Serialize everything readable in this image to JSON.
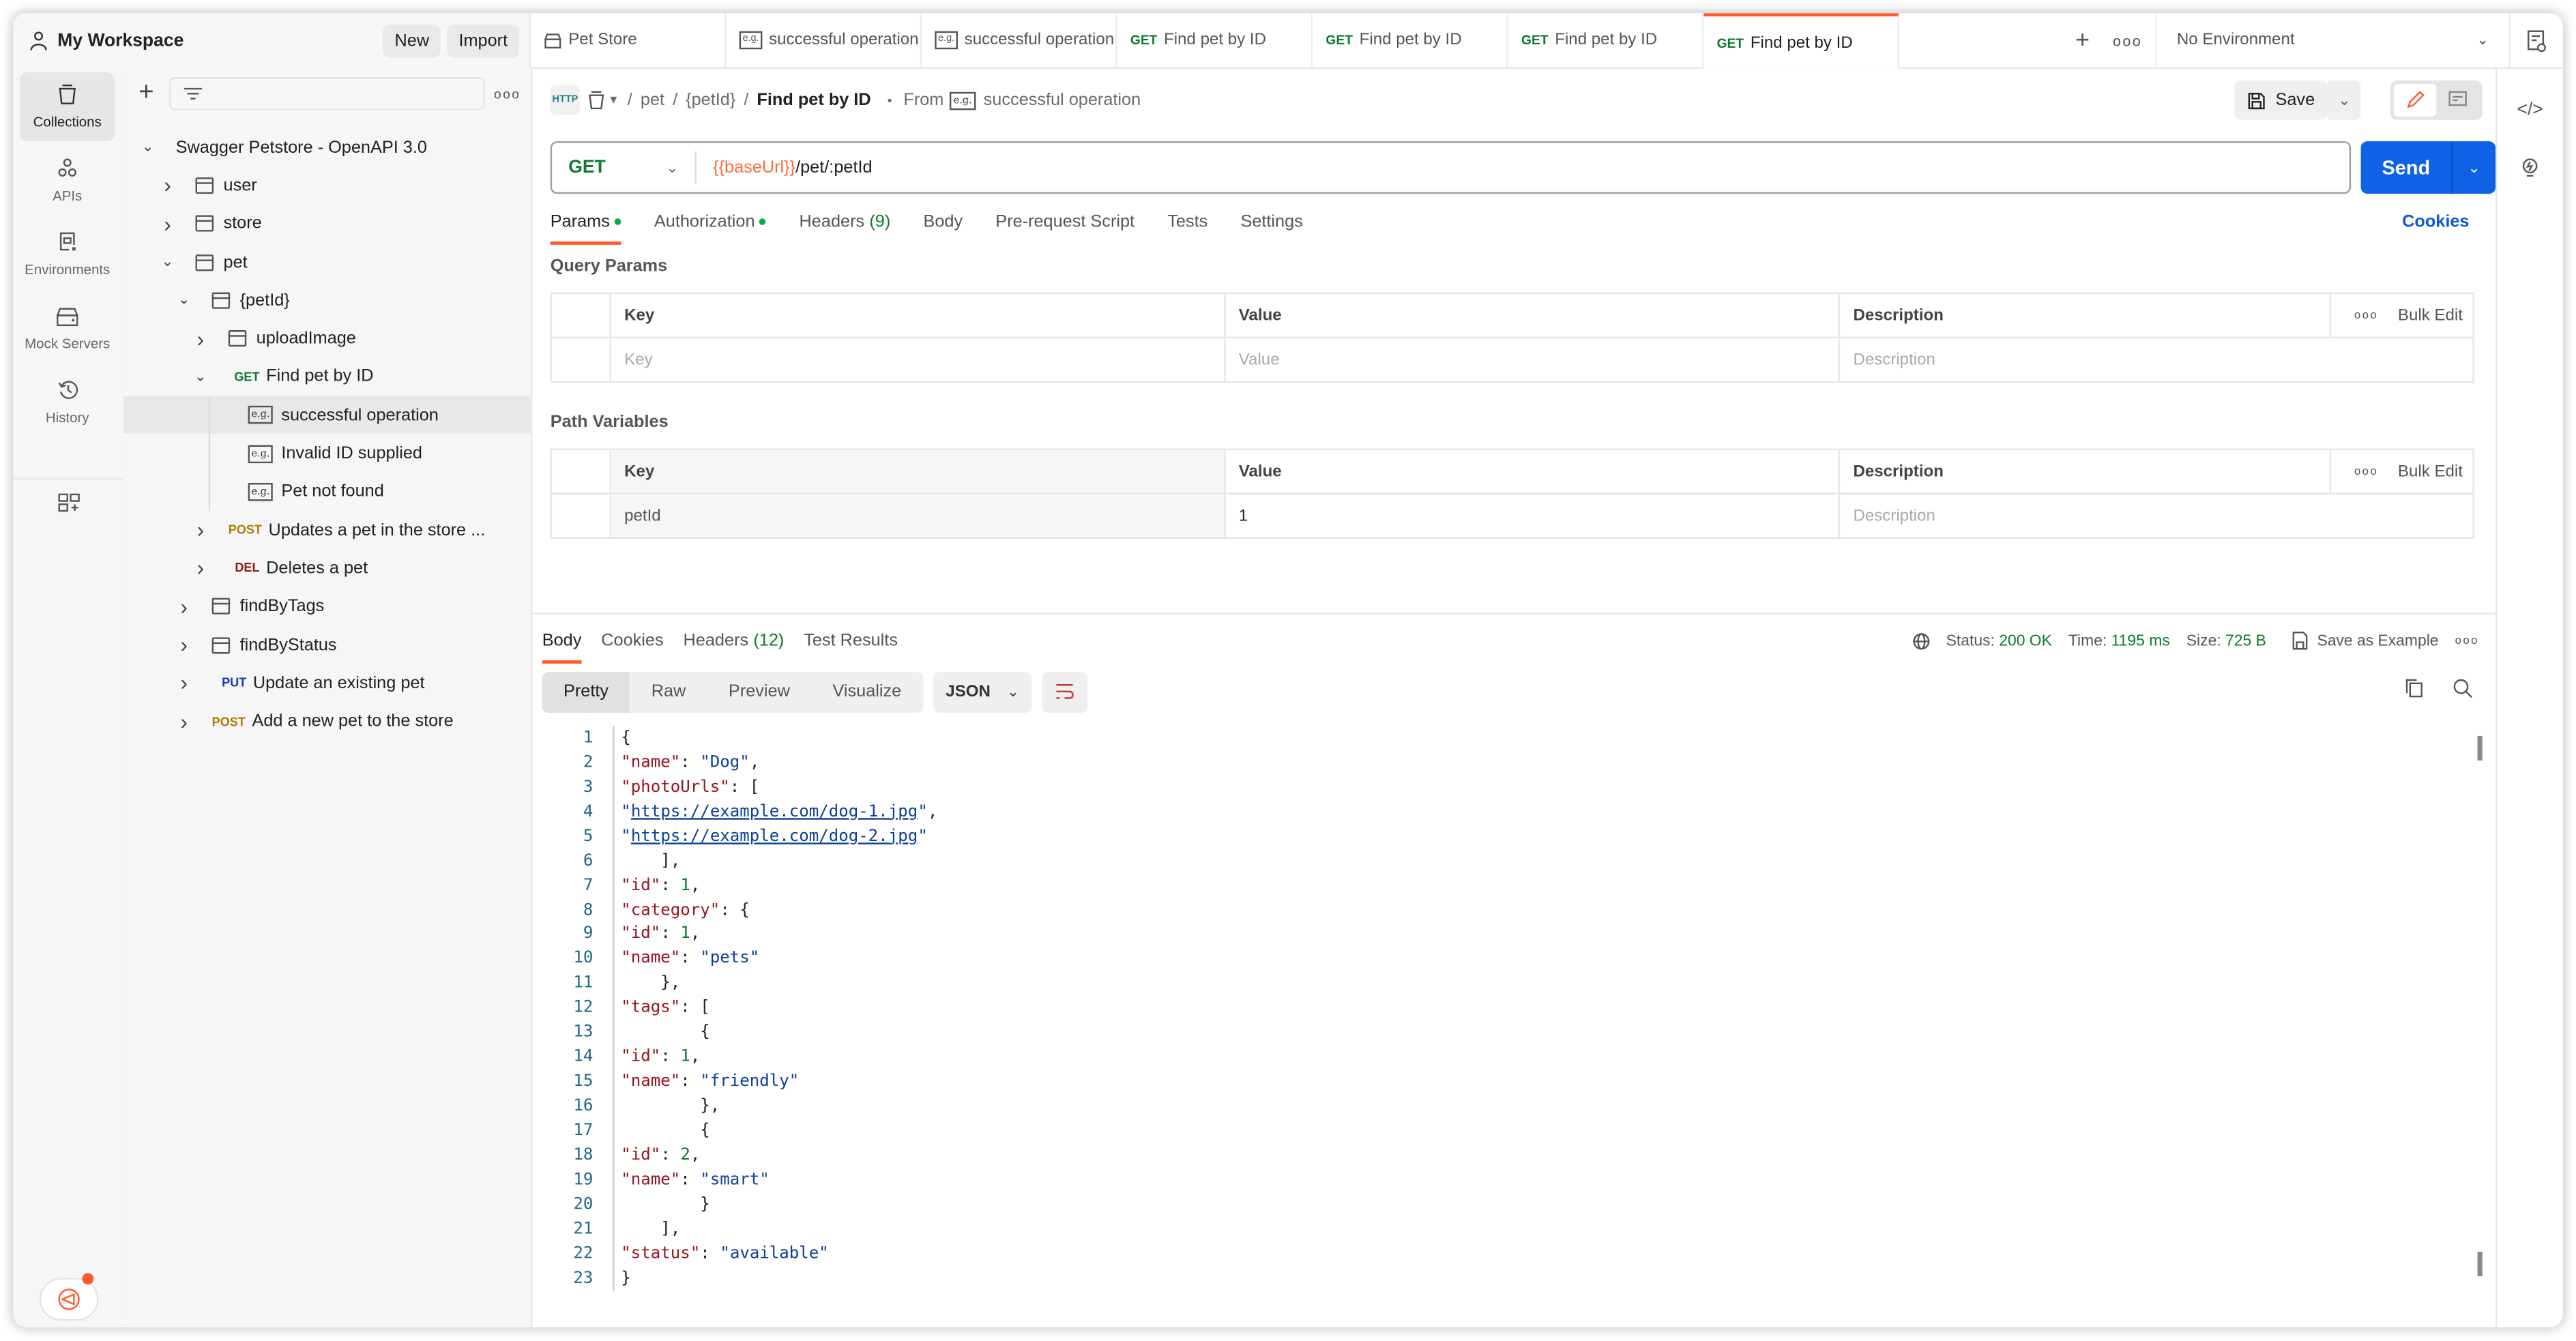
{
  "workspace": {
    "title": "My Workspace",
    "new_label": "New",
    "import_label": "Import"
  },
  "tabs": [
    {
      "icon": "mock-server-icon",
      "method": "",
      "label": "Pet Store",
      "active": false
    },
    {
      "icon": "example-icon",
      "method": "",
      "label": "successful operation",
      "active": false
    },
    {
      "icon": "example-icon",
      "method": "",
      "label": "successful operation",
      "active": false
    },
    {
      "icon": "",
      "method": "GET",
      "label": "Find pet by ID",
      "active": false
    },
    {
      "icon": "",
      "method": "GET",
      "label": "Find pet by ID",
      "active": false
    },
    {
      "icon": "",
      "method": "GET",
      "label": "Find pet by ID",
      "active": false
    },
    {
      "icon": "",
      "method": "GET",
      "label": "Find pet by ID",
      "active": true
    }
  ],
  "environment": {
    "selected": "No Environment"
  },
  "leftnav": [
    {
      "label": "Collections",
      "icon": "collections-icon",
      "active": true
    },
    {
      "label": "APIs",
      "icon": "apis-icon",
      "active": false
    },
    {
      "label": "Environments",
      "icon": "environments-icon",
      "active": false
    },
    {
      "label": "Mock Servers",
      "icon": "mock-servers-icon",
      "active": false
    },
    {
      "label": "History",
      "icon": "history-icon",
      "active": false
    }
  ],
  "tree": {
    "collection": "Swagger Petstore - OpenAPI 3.0",
    "items": [
      {
        "depth": 1,
        "chev": "right",
        "type": "folder",
        "label": "user"
      },
      {
        "depth": 1,
        "chev": "right",
        "type": "folder",
        "label": "store"
      },
      {
        "depth": 1,
        "chev": "down",
        "type": "folder",
        "label": "pet"
      },
      {
        "depth": 2,
        "chev": "down",
        "type": "folder",
        "label": "{petId}"
      },
      {
        "depth": 3,
        "chev": "right",
        "type": "folder",
        "label": "uploadImage"
      },
      {
        "depth": 3,
        "chev": "down",
        "type": "request",
        "method": "GET",
        "label": "Find pet by ID"
      },
      {
        "depth": 4,
        "chev": "",
        "type": "example",
        "label": "successful operation",
        "selected": true
      },
      {
        "depth": 4,
        "chev": "",
        "type": "example",
        "label": "Invalid ID supplied"
      },
      {
        "depth": 4,
        "chev": "",
        "type": "example",
        "label": "Pet not found"
      },
      {
        "depth": 3,
        "chev": "right",
        "type": "request",
        "method": "POST",
        "label": "Updates a pet in the store ..."
      },
      {
        "depth": 3,
        "chev": "right",
        "type": "request",
        "method": "DEL",
        "label": "Deletes a pet"
      },
      {
        "depth": 2,
        "chev": "right",
        "type": "folder",
        "label": "findByTags"
      },
      {
        "depth": 2,
        "chev": "right",
        "type": "folder",
        "label": "findByStatus"
      },
      {
        "depth": 2,
        "chev": "right",
        "type": "request",
        "method": "PUT",
        "label": "Update an existing pet"
      },
      {
        "depth": 2,
        "chev": "right",
        "type": "request",
        "method": "POST",
        "label": "Add a new pet to the store"
      }
    ]
  },
  "breadcrumb": {
    "parts": [
      "pet",
      "{petId}"
    ],
    "current": "Find pet by ID",
    "from_label": "From",
    "from_example": "successful operation"
  },
  "toolbar": {
    "save_label": "Save"
  },
  "request": {
    "method": "GET",
    "url_var": "{{baseUrl}}",
    "url_path": "/pet/:petId",
    "send_label": "Send"
  },
  "req_tabs": [
    {
      "label": "Params",
      "dot": true,
      "count": "",
      "active": true
    },
    {
      "label": "Authorization",
      "dot": true,
      "count": "",
      "active": false
    },
    {
      "label": "Headers",
      "dot": false,
      "count": "(9)",
      "active": false
    },
    {
      "label": "Body",
      "dot": false,
      "count": "",
      "active": false
    },
    {
      "label": "Pre-request Script",
      "dot": false,
      "count": "",
      "active": false
    },
    {
      "label": "Tests",
      "dot": false,
      "count": "",
      "active": false
    },
    {
      "label": "Settings",
      "dot": false,
      "count": "",
      "active": false
    }
  ],
  "cookies_label": "Cookies",
  "query_params": {
    "title": "Query Params",
    "headers": {
      "key": "Key",
      "value": "Value",
      "description": "Description",
      "bulk_edit": "Bulk Edit"
    },
    "placeholder": {
      "key": "Key",
      "value": "Value",
      "description": "Description"
    }
  },
  "path_variables": {
    "title": "Path Variables",
    "headers": {
      "key": "Key",
      "value": "Value",
      "description": "Description",
      "bulk_edit": "Bulk Edit"
    },
    "rows": [
      {
        "key": "petId",
        "value": "1",
        "description_placeholder": "Description"
      }
    ]
  },
  "response": {
    "tabs": [
      {
        "label": "Body",
        "count": "",
        "active": true
      },
      {
        "label": "Cookies",
        "count": "",
        "active": false
      },
      {
        "label": "Headers",
        "count": "(12)",
        "active": false
      },
      {
        "label": "Test Results",
        "count": "",
        "active": false
      }
    ],
    "status_label": "Status:",
    "status_value": "200 OK",
    "time_label": "Time:",
    "time_value": "1195 ms",
    "size_label": "Size:",
    "size_value": "725 B",
    "save_example_label": "Save as Example",
    "views": [
      "Pretty",
      "Raw",
      "Preview",
      "Visualize"
    ],
    "active_view": "Pretty",
    "format": "JSON",
    "lines": [
      "{",
      "    \"name\": \"Dog\",",
      "    \"photoUrls\": [",
      "        \"https://example.com/dog-1.jpg\",",
      "        \"https://example.com/dog-2.jpg\"",
      "    ],",
      "    \"id\": 1,",
      "    \"category\": {",
      "        \"id\": 1,",
      "        \"name\": \"pets\"",
      "    },",
      "    \"tags\": [",
      "        {",
      "            \"id\": 1,",
      "            \"name\": \"friendly\"",
      "        },",
      "        {",
      "            \"id\": 2,",
      "            \"name\": \"smart\"",
      "        }",
      "    ],",
      "    \"status\": \"available\"",
      "}"
    ]
  },
  "colors": {
    "accent": "#ff5a2b",
    "send": "#0f62e6",
    "get": "#0b7a2d",
    "post": "#ad7a03",
    "del": "#8e1a10",
    "put": "#0c3fb3"
  }
}
